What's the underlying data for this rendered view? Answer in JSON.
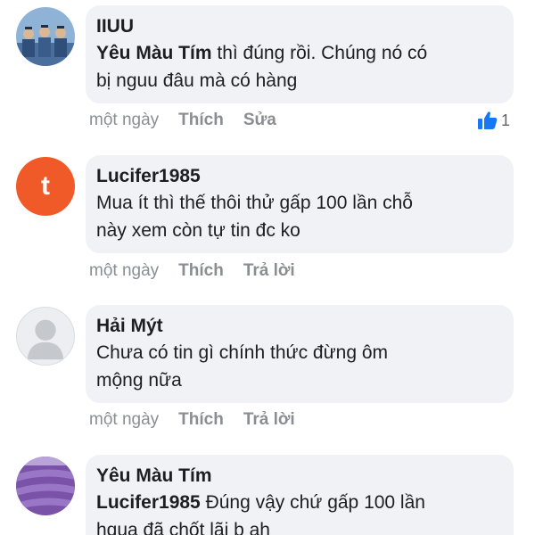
{
  "comments": [
    {
      "author": "IIUU",
      "mention": "Yêu Màu Tím",
      "text_line1": " thì đúng rồi. Chúng nó có",
      "text_line2": "bị nguu đâu mà có hàng",
      "time": "một ngày",
      "like": "Thích",
      "second_action": "Sửa",
      "like_count": "1",
      "avatar": "group-photo"
    },
    {
      "author": "Lucifer1985",
      "text_line1": "Mua ít thì thế thôi thử gấp 100 lần chỗ",
      "text_line2": "này xem còn tự tin đc ko",
      "time": "một ngày",
      "like": "Thích",
      "second_action": "Trả lời",
      "avatar_letter": "t",
      "avatar_color": "#f05a28"
    },
    {
      "author": "Hải Mýt",
      "text_line1": "Chưa có tin gì chính thức đừng ôm",
      "text_line2": "mộng nữa",
      "time": "một ngày",
      "like": "Thích",
      "second_action": "Trả lời",
      "avatar": "default-silhouette"
    },
    {
      "author": "Yêu Màu Tím",
      "mention": "Lucifer1985",
      "text_line1": " Đúng vậy chứ gấp 100 lần",
      "text_line2": "hqua đã chốt lãi b ah",
      "avatar": "lavender-field"
    }
  ],
  "colors": {
    "bubble": "#f0f2f5",
    "meta": "#8a8d91",
    "like_blue": "#1877f2"
  }
}
